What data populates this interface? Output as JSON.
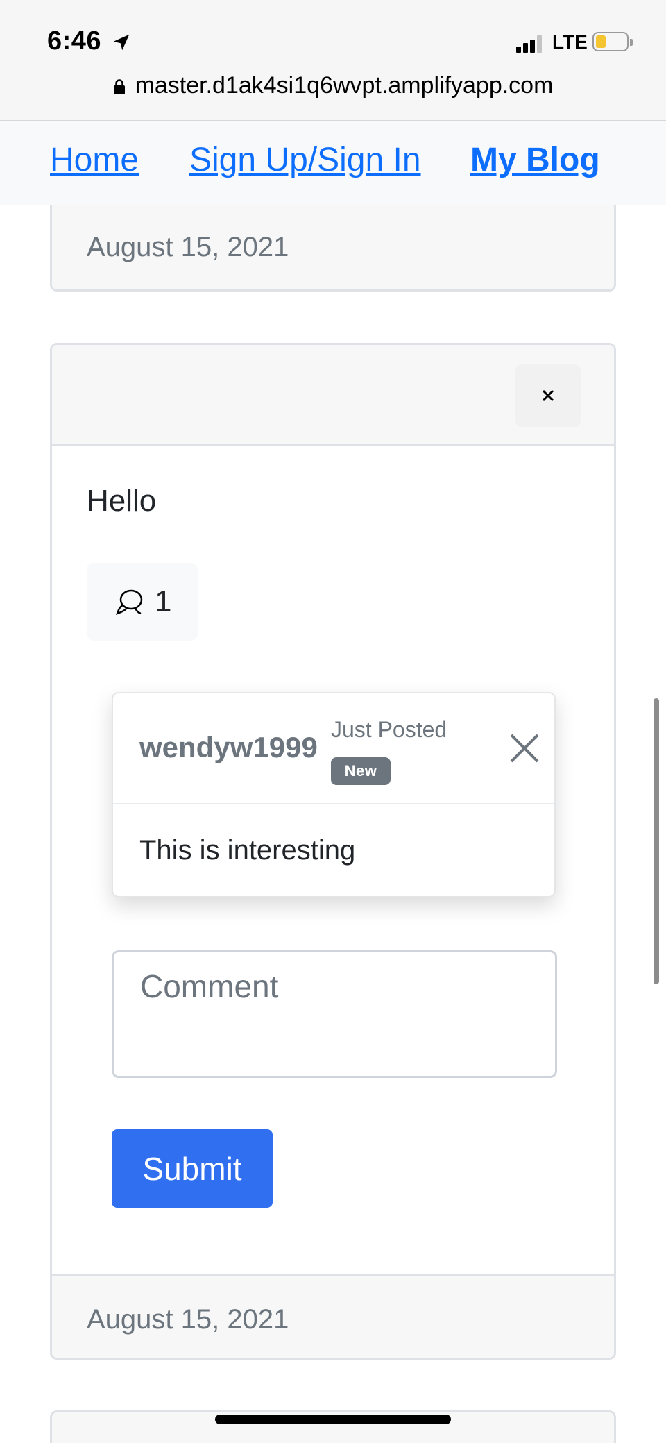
{
  "status_bar": {
    "time": "6:46",
    "network": "LTE"
  },
  "url_bar": {
    "url": "master.d1ak4si1q6wvpt.amplifyapp.com"
  },
  "navbar": {
    "items": [
      {
        "label": "Home"
      },
      {
        "label": "Sign Up/Sign In"
      },
      {
        "label": "My Blog"
      }
    ]
  },
  "previous_card": {
    "date": "August 15, 2021"
  },
  "post": {
    "close_label": "×",
    "text": "Hello",
    "comment_count": "1",
    "comment": {
      "username": "wendyw1999",
      "posted": "Just Posted",
      "badge": "New",
      "body": "This is interesting"
    },
    "comment_placeholder": "Comment",
    "submit_label": "Submit",
    "date": "August 15, 2021"
  },
  "colors": {
    "link": "#0d6efd",
    "submit": "#2f6ff0",
    "muted": "#6c757d",
    "battery": "#f5c431"
  }
}
